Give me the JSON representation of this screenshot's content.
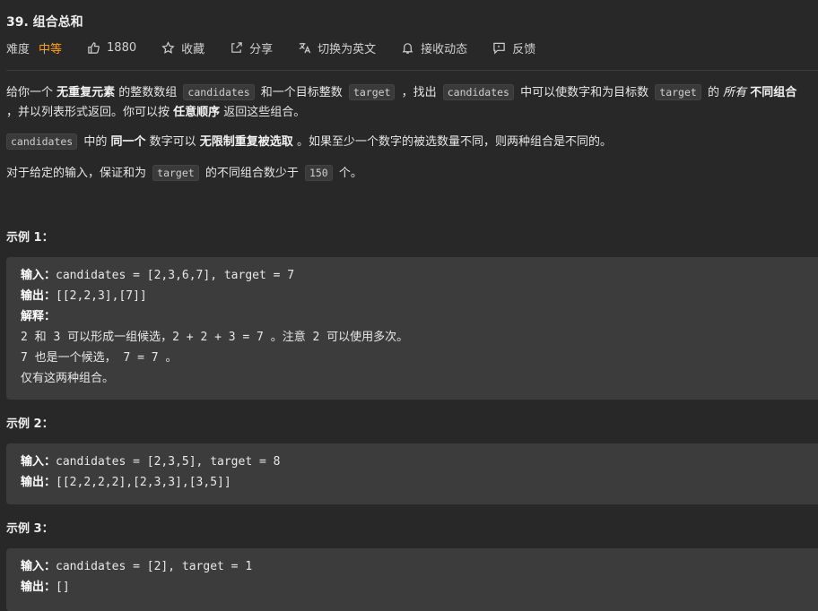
{
  "problem": {
    "title": "39. 组合总和",
    "difficulty_label": "难度",
    "difficulty": "中等",
    "difficulty_color": "#ffa116",
    "likes": "1880",
    "favorite_label": "收藏",
    "share_label": "分享",
    "switch_lang_label": "切换为英文",
    "notify_label": "接收动态",
    "feedback_label": "反馈"
  },
  "description": {
    "p1": {
      "a": "给你一个 ",
      "b1": "无重复元素",
      "c": " 的整数数组 ",
      "code1": "candidates",
      "d": " 和一个目标整数 ",
      "code2": "target",
      "e": " ，找出 ",
      "code3": "candidates",
      "f": " 中可以使数字和为目标数 ",
      "code4": "target",
      "g": " 的 ",
      "i1": "所有",
      "h": " ",
      "b2": "不同组合",
      "line2a": " ，并以列表形式返回。你可以按 ",
      "b3": "任意顺序",
      "line2b": " 返回这些组合。"
    },
    "p2": {
      "code1": "candidates",
      "a": " 中的 ",
      "b1": "同一个",
      "b": " 数字可以 ",
      "b2": "无限制重复被选取",
      "c": " 。如果至少一个数字的被选数量不同，则两种组合是不同的。"
    },
    "p3": {
      "a": "对于给定的输入，保证和为 ",
      "code1": "target",
      "b": " 的不同组合数少于 ",
      "code2": "150",
      "c": " 个。"
    }
  },
  "examples": [
    {
      "heading": "示例 1：",
      "input_label": "输入：",
      "input": "candidates = [2,3,6,7], target = 7",
      "output_label": "输出：",
      "output": "[[2,2,3],[7]]",
      "explain_label": "解释：",
      "explain_lines": [
        "2 和 3 可以形成一组候选，2 + 2 + 3 = 7 。注意 2 可以使用多次。",
        "7 也是一个候选， 7 = 7 。",
        "仅有这两种组合。"
      ]
    },
    {
      "heading": "示例 2：",
      "input_label": "输入：",
      "input": "candidates = [2,3,5], target = 8",
      "output_label": "输出：",
      "output": "[[2,2,2,2],[2,3,3],[3,5]]"
    },
    {
      "heading": "示例 3：",
      "input_label": "输入：",
      "input": "candidates = [2], target = 1",
      "output_label": "输出：",
      "output": "[]"
    }
  ]
}
